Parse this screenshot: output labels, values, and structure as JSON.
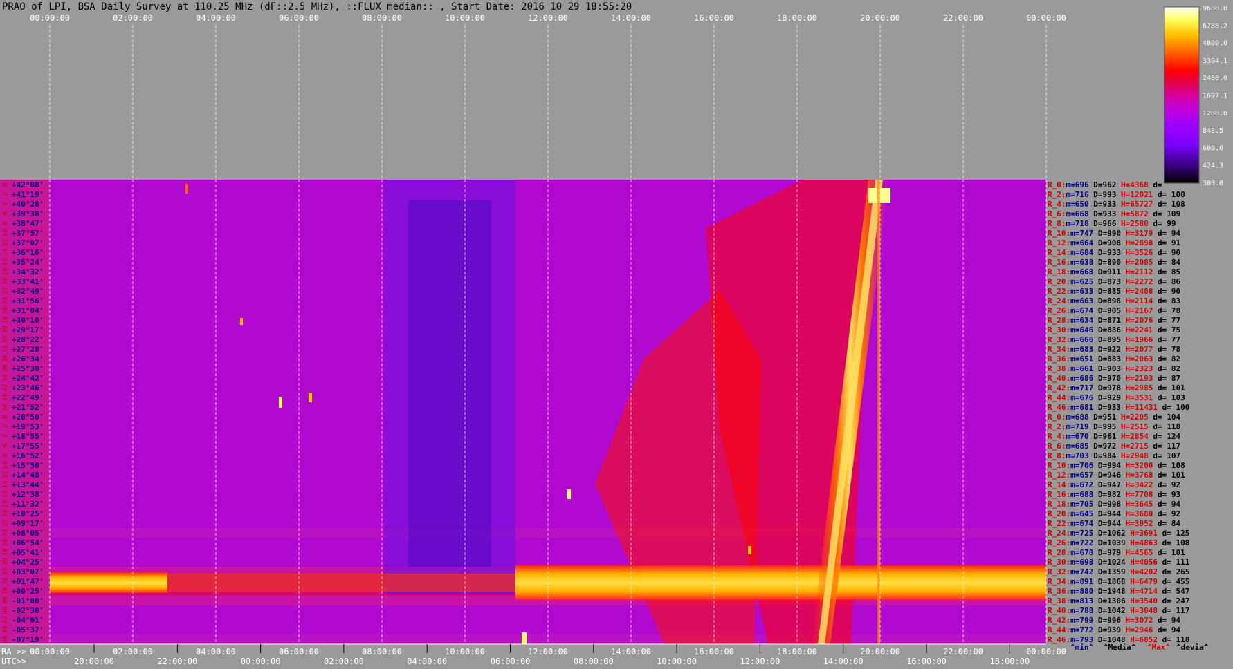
{
  "title": "PRAO of LPI, BSA Daily Survey at 110.25 MHz (dF::2.5 MHz), ::FLUX_median:: , Start Date: 2016 10 29 18:55:20",
  "top_time_ticks": [
    "00:00:00",
    "02:00:00",
    "04:00:00",
    "06:00:00",
    "08:00:00",
    "10:00:00",
    "12:00:00",
    "14:00:00",
    "16:00:00",
    "18:00:00",
    "20:00:00",
    "22:00:00",
    "00:00:00"
  ],
  "ra_row_label": "RA >>",
  "ra_ticks": [
    "00:00:00",
    "02:00:00",
    "04:00:00",
    "06:00:00",
    "08:00:00",
    "10:00:00",
    "12:00:00",
    "14:00:00",
    "16:00:00",
    "18:00:00",
    "20:00:00",
    "22:00:00",
    "00:00:00"
  ],
  "utc_row_label": "UTC>>",
  "utc_ticks": [
    "20:00:00",
    "22:00:00",
    "00:00:00",
    "02:00:00",
    "04:00:00",
    "06:00:00",
    "08:00:00",
    "10:00:00",
    "12:00:00",
    "14:00:00",
    "16:00:00",
    "18:00:00"
  ],
  "colorbar_ticks": [
    "9600.0",
    "6788.2",
    "4800.0",
    "3394.1",
    "2400.0",
    "1697.1",
    "1200.0",
    "848.5",
    "600.0",
    "424.3",
    "300.0"
  ],
  "beam_numbers": [
    "0",
    "2",
    "4",
    "6",
    "8",
    "10",
    "12",
    "14",
    "16",
    "18",
    "20",
    "22",
    "24",
    "26",
    "28",
    "30",
    "32",
    "34",
    "36",
    "38",
    "40",
    "42",
    "44",
    "46",
    "0",
    "2",
    "4",
    "6",
    "8",
    "10",
    "12",
    "14",
    "16",
    "18",
    "20",
    "22",
    "24",
    "26",
    "28",
    "30",
    "32",
    "34",
    "36",
    "38",
    "40",
    "42",
    "44",
    "46"
  ],
  "declinations": [
    "+42°08'",
    "+41°19'",
    "+40°28'",
    "+39°38'",
    "+38°47'",
    "+37°57'",
    "+37°07'",
    "+36°16'",
    "+35°24'",
    "+34°32'",
    "+33°41'",
    "+32°49'",
    "+31°56'",
    "+31°04'",
    "+30°10'",
    "+29°17'",
    "+28°22'",
    "+27°28'",
    "+26°34'",
    "+25°38'",
    "+24°42'",
    "+23°46'",
    "+22°49'",
    "+21°52'",
    "+20°50'",
    "+19°53'",
    "+18°55'",
    "+17°55'",
    "+16°52'",
    "+15°50'",
    "+14°48'",
    "+13°44'",
    "+12°38'",
    "+11°32'",
    "+10°25'",
    "+09°17'",
    "+08°05'",
    "+06°54'",
    "+05°41'",
    "+04°25'",
    "+03°07'",
    "+01°47'",
    "+00°25'",
    "-01°00'",
    "-02°30'",
    "-04°01'",
    "-05°37'",
    "-07°19'"
  ],
  "stats_header": [
    "^min^",
    "^Media^",
    "^Max^",
    "^devia^"
  ],
  "stats_rows": [
    {
      "r": "R_0:",
      "m": "m=696",
      "d": "D=962",
      "h": "H=4368",
      "dv": "d="
    },
    {
      "r": "R_2:",
      "m": "m=716",
      "d": "D=993",
      "h": "H=12021",
      "dv": "d= 108"
    },
    {
      "r": "R_4:",
      "m": "m=650",
      "d": "D=933",
      "h": "H=65727",
      "dv": "d= 108"
    },
    {
      "r": "R_6:",
      "m": "m=668",
      "d": "D=933",
      "h": "H=5872",
      "dv": "d= 109"
    },
    {
      "r": "R_8:",
      "m": "m=718",
      "d": "D=966",
      "h": "H=2580",
      "dv": "d= 99"
    },
    {
      "r": "R_10:",
      "m": "m=747",
      "d": "D=990",
      "h": "H=3179",
      "dv": "d= 94"
    },
    {
      "r": "R_12:",
      "m": "m=664",
      "d": "D=908",
      "h": "H=2898",
      "dv": "d= 91"
    },
    {
      "r": "R_14:",
      "m": "m=684",
      "d": "D=933",
      "h": "H=3526",
      "dv": "d= 90"
    },
    {
      "r": "R_16:",
      "m": "m=638",
      "d": "D=890",
      "h": "H=2085",
      "dv": "d= 84"
    },
    {
      "r": "R_18:",
      "m": "m=668",
      "d": "D=911",
      "h": "H=2112",
      "dv": "d= 85"
    },
    {
      "r": "R_20:",
      "m": "m=625",
      "d": "D=873",
      "h": "H=2272",
      "dv": "d= 86"
    },
    {
      "r": "R_22:",
      "m": "m=633",
      "d": "D=885",
      "h": "H=2408",
      "dv": "d= 90"
    },
    {
      "r": "R_24:",
      "m": "m=663",
      "d": "D=898",
      "h": "H=2114",
      "dv": "d= 83"
    },
    {
      "r": "R_26:",
      "m": "m=674",
      "d": "D=905",
      "h": "H=2167",
      "dv": "d= 78"
    },
    {
      "r": "R_28:",
      "m": "m=634",
      "d": "D=871",
      "h": "H=2076",
      "dv": "d= 77"
    },
    {
      "r": "R_30:",
      "m": "m=646",
      "d": "D=886",
      "h": "H=2241",
      "dv": "d= 75"
    },
    {
      "r": "R_32:",
      "m": "m=666",
      "d": "D=895",
      "h": "H=1966",
      "dv": "d= 77"
    },
    {
      "r": "R_34:",
      "m": "m=683",
      "d": "D=922",
      "h": "H=2077",
      "dv": "d= 78"
    },
    {
      "r": "R_36:",
      "m": "m=651",
      "d": "D=883",
      "h": "H=2063",
      "dv": "d= 82"
    },
    {
      "r": "R_38:",
      "m": "m=661",
      "d": "D=903",
      "h": "H=2323",
      "dv": "d= 82"
    },
    {
      "r": "R_40:",
      "m": "m=686",
      "d": "D=970",
      "h": "H=2193",
      "dv": "d= 87"
    },
    {
      "r": "R_42:",
      "m": "m=717",
      "d": "D=978",
      "h": "H=2985",
      "dv": "d= 101"
    },
    {
      "r": "R_44:",
      "m": "m=676",
      "d": "D=929",
      "h": "H=3531",
      "dv": "d= 103"
    },
    {
      "r": "R_46:",
      "m": "m=681",
      "d": "D=933",
      "h": "H=11431",
      "dv": "d= 100"
    },
    {
      "r": "R_0:",
      "m": "m=688",
      "d": "D=951",
      "h": "H=2205",
      "dv": "d= 104"
    },
    {
      "r": "R_2:",
      "m": "m=719",
      "d": "D=995",
      "h": "H=2515",
      "dv": "d= 118"
    },
    {
      "r": "R_4:",
      "m": "m=670",
      "d": "D=961",
      "h": "H=2854",
      "dv": "d= 124"
    },
    {
      "r": "R_6:",
      "m": "m=685",
      "d": "D=972",
      "h": "H=2715",
      "dv": "d= 117"
    },
    {
      "r": "R_8:",
      "m": "m=703",
      "d": "D=984",
      "h": "H=2948",
      "dv": "d= 107"
    },
    {
      "r": "R_10:",
      "m": "m=706",
      "d": "D=994",
      "h": "H=3200",
      "dv": "d= 108"
    },
    {
      "r": "R_12:",
      "m": "m=657",
      "d": "D=946",
      "h": "H=3768",
      "dv": "d= 101"
    },
    {
      "r": "R_14:",
      "m": "m=672",
      "d": "D=947",
      "h": "H=3422",
      "dv": "d= 92"
    },
    {
      "r": "R_16:",
      "m": "m=688",
      "d": "D=982",
      "h": "H=7708",
      "dv": "d= 93"
    },
    {
      "r": "R_18:",
      "m": "m=705",
      "d": "D=998",
      "h": "H=3645",
      "dv": "d= 94"
    },
    {
      "r": "R_20:",
      "m": "m=645",
      "d": "D=944",
      "h": "H=3680",
      "dv": "d= 92"
    },
    {
      "r": "R_22:",
      "m": "m=674",
      "d": "D=944",
      "h": "H=3952",
      "dv": "d= 84"
    },
    {
      "r": "R_24:",
      "m": "m=725",
      "d": "D=1062",
      "h": "H=3691",
      "dv": "d= 125"
    },
    {
      "r": "R_26:",
      "m": "m=722",
      "d": "D=1039",
      "h": "H=4863",
      "dv": "d= 108"
    },
    {
      "r": "R_28:",
      "m": "m=678",
      "d": "D=979",
      "h": "H=4565",
      "dv": "d= 101"
    },
    {
      "r": "R_30:",
      "m": "m=698",
      "d": "D=1024",
      "h": "H=4056",
      "dv": "d= 111"
    },
    {
      "r": "R_32:",
      "m": "m=742",
      "d": "D=1359",
      "h": "H=4202",
      "dv": "d= 265"
    },
    {
      "r": "R_34:",
      "m": "m=891",
      "d": "D=1868",
      "h": "H=6479",
      "dv": "d= 455"
    },
    {
      "r": "R_36:",
      "m": "m=880",
      "d": "D=1948",
      "h": "H=4714",
      "dv": "d= 547"
    },
    {
      "r": "R_38:",
      "m": "m=813",
      "d": "D=1306",
      "h": "H=3540",
      "dv": "d= 247"
    },
    {
      "r": "R_40:",
      "m": "m=788",
      "d": "D=1042",
      "h": "H=3048",
      "dv": "d= 117"
    },
    {
      "r": "R_42:",
      "m": "m=799",
      "d": "D=996",
      "h": "H=3072",
      "dv": "d= 94"
    },
    {
      "r": "R_44:",
      "m": "m=772",
      "d": "D=939",
      "h": "H=2946",
      "dv": "d= 94"
    },
    {
      "r": "R_46:",
      "m": "m=793",
      "d": "D=1048",
      "h": "H=6852",
      "dv": "d= 118"
    }
  ],
  "colors": {
    "background": "#9a9a9a",
    "beam_number": "#cc0000",
    "declination": "#000080",
    "stats_label": "#cc0000",
    "stats_min": "#000080",
    "stats_median": "#000000",
    "stats_max": "#cc0000",
    "colormap": [
      "#000000",
      "#3a0080",
      "#7a00ff",
      "#a000ff",
      "#cc00cc",
      "#e00060",
      "#ff0000",
      "#ff6000",
      "#ffc000",
      "#ffff60",
      "#ffffff"
    ]
  },
  "chart_data": {
    "type": "heatmap",
    "title": "PRAO of LPI, BSA Daily Survey at 110.25 MHz (dF::2.5 MHz), ::FLUX_median:: , Start Date: 2016 10 29 18:55:20",
    "x_axis": "RA 00:00:00 – 24:00:00 (sidereal)",
    "rows": 48,
    "colorbar_range": [
      300.0,
      9600.0
    ],
    "colorbar_scale": "log",
    "features": [
      {
        "name": "cold sky region",
        "ra_range": [
          "08:00:00",
          "12:00:00"
        ],
        "beams": "0-46 (set 1), 0-34 (set 2)"
      },
      {
        "name": "drifting bright source track",
        "ra_range": [
          "17:30:00",
          "20:10:00"
        ],
        "dec_range": [
          "-07°19'",
          "+42°08'"
        ]
      },
      {
        "name": "bright equatorial band",
        "dec_range": [
          "-01°00'",
          "+03°07'"
        ],
        "ra_range": [
          "11:30:00",
          "24:00:00"
        ]
      }
    ],
    "median_D": [
      962,
      993,
      933,
      933,
      966,
      990,
      908,
      933,
      890,
      911,
      873,
      885,
      898,
      905,
      871,
      886,
      895,
      922,
      883,
      903,
      970,
      978,
      929,
      933,
      951,
      995,
      961,
      972,
      984,
      994,
      946,
      947,
      982,
      998,
      944,
      944,
      1062,
      1039,
      979,
      1024,
      1359,
      1868,
      1948,
      1306,
      1042,
      996,
      939,
      1048
    ]
  }
}
